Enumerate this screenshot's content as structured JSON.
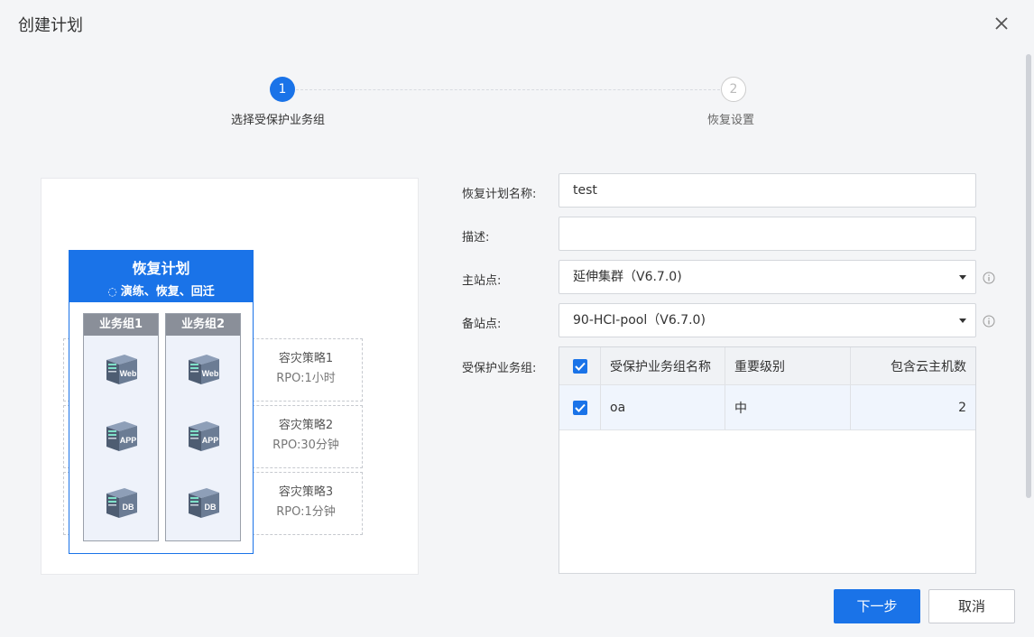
{
  "dialog": {
    "title": "创建计划"
  },
  "steps": [
    {
      "number": "1",
      "label": "选择受保护业务组"
    },
    {
      "number": "2",
      "label": "恢复设置"
    }
  ],
  "illustration": {
    "plan_title": "恢复计划",
    "plan_subtitle": "演练、恢复、回迁",
    "groups": [
      "业务组1",
      "业务组2"
    ],
    "server_labels": [
      "Web",
      "APP",
      "DB"
    ],
    "policies": [
      {
        "name": "容灾策略1",
        "rpo": "RPO:1小时"
      },
      {
        "name": "容灾策略2",
        "rpo": "RPO:30分钟"
      },
      {
        "name": "容灾策略3",
        "rpo": "RPO:1分钟"
      }
    ]
  },
  "form": {
    "plan_name_label": "恢复计划名称:",
    "plan_name_value": "test",
    "desc_label": "描述:",
    "desc_value": "",
    "primary_site_label": "主站点:",
    "primary_site_value": "延伸集群（V6.7.0)",
    "backup_site_label": "备站点:",
    "backup_site_value": "90-HCI-pool（V6.7.0)",
    "groups_label": "受保护业务组:"
  },
  "table": {
    "headers": [
      "受保护业务组名称",
      "重要级别",
      "包含云主机数"
    ],
    "rows": [
      {
        "name": "oa",
        "level": "中",
        "count": "2"
      }
    ]
  },
  "footer": {
    "next_label": "下一步",
    "cancel_label": "取消"
  },
  "colors": {
    "accent": "#1a73e8"
  }
}
